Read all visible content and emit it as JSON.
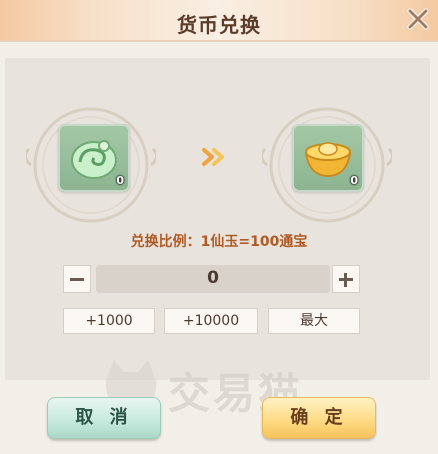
{
  "dialog": {
    "title": "货币兑换",
    "close_icon": "close-icon"
  },
  "exchange": {
    "from_item": {
      "icon": "jade-swirl-icon",
      "count": "0"
    },
    "to_item": {
      "icon": "gold-ingot-icon",
      "count": "0"
    },
    "arrow_icon": "double-chevron-right-icon",
    "ratio_text": "兑换比例：1仙玉=100通宝"
  },
  "quantity": {
    "value": "0",
    "minus_icon": "minus-icon",
    "plus_icon": "plus-icon"
  },
  "quick_buttons": [
    "+1000",
    "+10000",
    "最大"
  ],
  "actions": {
    "cancel": "取 消",
    "confirm": "确 定"
  },
  "watermark": "交易猫",
  "colors": {
    "accent": "#b05a24",
    "confirm": "#ffdc86",
    "cancel": "#c8eadf"
  }
}
